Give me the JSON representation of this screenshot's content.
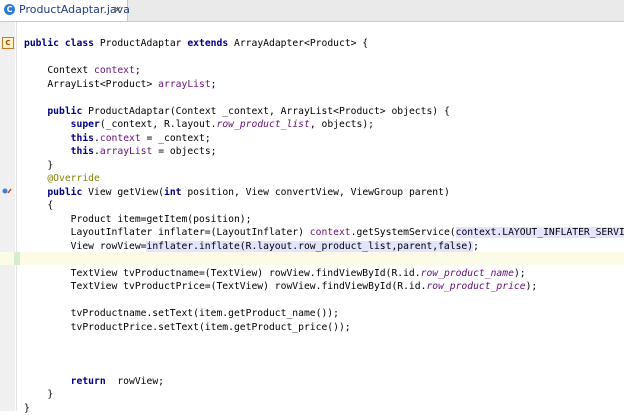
{
  "tab": {
    "icon": "C",
    "title": "ProductAdaptar.java",
    "close": "×"
  },
  "code": [
    [
      [
        "kw",
        "public class "
      ],
      [
        "",
        "ProductAdaptar "
      ],
      [
        "kw",
        "extends "
      ],
      [
        "",
        "ArrayAdapter<Product> {"
      ]
    ],
    [],
    [
      [
        "",
        "    Context "
      ],
      [
        "fld",
        "context"
      ],
      [
        "",
        ";"
      ]
    ],
    [
      [
        "",
        "    ArrayList<Product> "
      ],
      [
        "fld",
        "arrayList"
      ],
      [
        "",
        ";"
      ]
    ],
    [],
    [
      [
        "",
        "    "
      ],
      [
        "kw",
        "public "
      ],
      [
        "",
        "ProductAdaptar(Context _context, ArrayList<Product> objects) {"
      ]
    ],
    [
      [
        "",
        "        "
      ],
      [
        "kw",
        "super"
      ],
      [
        "",
        "(_context, R.layout."
      ],
      [
        "ital",
        "row_product_list"
      ],
      [
        "",
        ", objects);"
      ]
    ],
    [
      [
        "",
        "        "
      ],
      [
        "kw",
        "this"
      ],
      [
        "",
        "."
      ],
      [
        "fld",
        "context"
      ],
      [
        "",
        " = _context;"
      ]
    ],
    [
      [
        "",
        "        "
      ],
      [
        "kw",
        "this"
      ],
      [
        "",
        "."
      ],
      [
        "fld",
        "arrayList"
      ],
      [
        "",
        " = objects;"
      ]
    ],
    [
      [
        "",
        "    }"
      ]
    ],
    [
      [
        "",
        "    "
      ],
      [
        "ann",
        "@Override"
      ]
    ],
    [
      [
        "",
        "    "
      ],
      [
        "kw",
        "public "
      ],
      [
        "",
        "View getView("
      ],
      [
        "kw",
        "int "
      ],
      [
        "",
        "position, View convertView, ViewGroup parent)"
      ]
    ],
    [
      [
        "",
        "    {"
      ]
    ],
    [
      [
        "",
        "        Product item=getItem(position);"
      ]
    ],
    [
      [
        "",
        "        LayoutInflater inflater=(LayoutInflater) "
      ],
      [
        "fld",
        "context"
      ],
      [
        "",
        ".getSystemService("
      ],
      [
        "ref",
        "context.LAYOUT_INFLATER_SERVICE"
      ],
      [
        "",
        ");"
      ]
    ],
    [
      [
        "",
        "        View rowView="
      ],
      [
        "ref",
        "inflater.inflate(R.layout.row_product_list,parent,false)"
      ],
      [
        "",
        ";"
      ]
    ],
    [],
    [
      [
        "",
        "        TextView tvProductname=(TextView) rowView.findViewById(R.id."
      ],
      [
        "ital",
        "row_product_name"
      ],
      [
        "",
        ");"
      ]
    ],
    [
      [
        "",
        "        TextView tvProductPrice=(TextView) rowView.findViewById(R.id."
      ],
      [
        "ital",
        "row_product_price"
      ],
      [
        "",
        ");"
      ]
    ],
    [],
    [
      [
        "",
        "        tvProductname.setText(item.getProduct_name());"
      ]
    ],
    [
      [
        "",
        "        tvProductPrice.setText(item.getProduct_price());"
      ]
    ],
    [],
    [],
    [],
    [
      [
        "",
        "        "
      ],
      [
        "kw",
        "return  "
      ],
      [
        "",
        "rowView;"
      ]
    ],
    [
      [
        "",
        "    }"
      ]
    ],
    [
      [
        "",
        "}"
      ]
    ]
  ]
}
